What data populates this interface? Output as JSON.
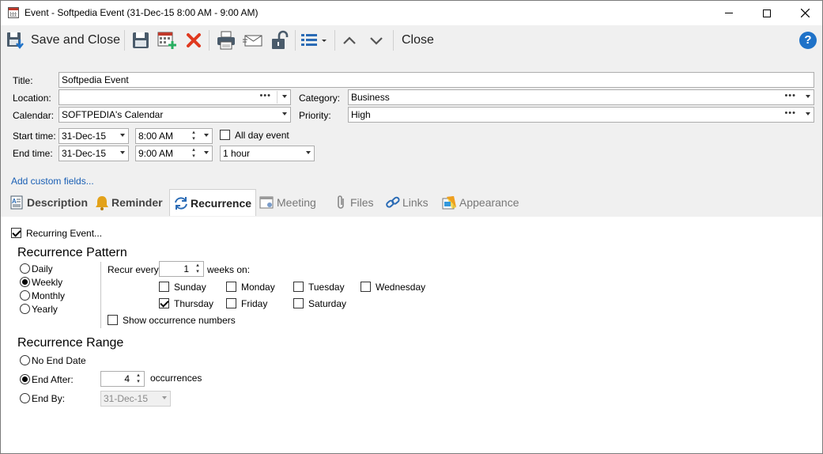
{
  "window": {
    "title": "Event - Softpedia Event (31-Dec-15 8:00 AM - 9:00 AM)"
  },
  "toolbar": {
    "save_and_close": "Save and Close",
    "close": "Close",
    "help": "?"
  },
  "form": {
    "title_label": "Title:",
    "title_value": "Softpedia Event",
    "location_label": "Location:",
    "location_value": "",
    "category_label": "Category:",
    "category_value": "Business",
    "calendar_label": "Calendar:",
    "calendar_value": "SOFTPEDIA's Calendar",
    "priority_label": "Priority:",
    "priority_value": "High",
    "start_label": "Start time:",
    "start_date": "31-Dec-15",
    "start_time": "8:00 AM",
    "end_label": "End time:",
    "end_date": "31-Dec-15",
    "end_time": "9:00 AM",
    "all_day_label": "All day event",
    "duration": "1 hour",
    "custom_fields_link": "Add custom fields...",
    "dots": "•••"
  },
  "tabs": [
    {
      "label": "Description"
    },
    {
      "label": "Reminder"
    },
    {
      "label": "Recurrence"
    },
    {
      "label": "Meeting"
    },
    {
      "label": "Files"
    },
    {
      "label": "Links"
    },
    {
      "label": "Appearance"
    }
  ],
  "recurrence": {
    "recurring_label": "Recurring Event...",
    "pattern_title": "Recurrence Pattern",
    "daily": "Daily",
    "weekly": "Weekly",
    "monthly": "Monthly",
    "yearly": "Yearly",
    "recur_every_label": "Recur every",
    "recur_every_value": "1",
    "weeks_on_label": "weeks on:",
    "days": {
      "sunday": "Sunday",
      "monday": "Monday",
      "tuesday": "Tuesday",
      "wednesday": "Wednesday",
      "thursday": "Thursday",
      "friday": "Friday",
      "saturday": "Saturday"
    },
    "show_occurrence_numbers": "Show occurrence numbers",
    "range_title": "Recurrence Range",
    "no_end_date": "No End Date",
    "end_after": "End After:",
    "end_after_value": "4",
    "occurrences": "occurrences",
    "end_by": "End By:",
    "end_by_value": "31-Dec-15"
  },
  "colors": {
    "panel": "#f0f0f0",
    "link": "#1a5fb4",
    "delete_red": "#e0391f",
    "toolbar_blue": "#2a6bb5",
    "help_blue": "#1f72c8"
  }
}
